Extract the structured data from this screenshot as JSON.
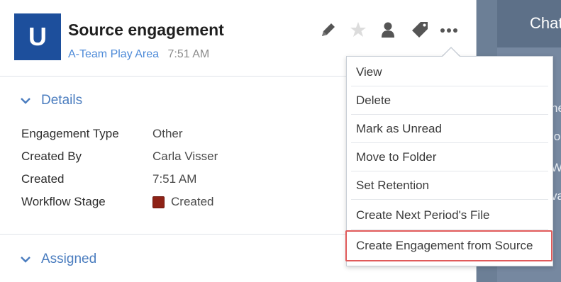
{
  "engagement": {
    "avatar_letter": "U",
    "title": "Source engagement",
    "folder": "A-Team Play Area",
    "time": "7:51 AM"
  },
  "toolbar": {
    "icons": [
      "pencil-icon",
      "star-icon",
      "person-icon",
      "tag-icon",
      "more-icon"
    ]
  },
  "details": {
    "heading": "Details",
    "fields": [
      {
        "label": "Engagement Type",
        "value": "Other"
      },
      {
        "label": "Created By",
        "value": "Carla Visser"
      },
      {
        "label": "Created",
        "value": "7:51 AM"
      },
      {
        "label": "Workflow Stage",
        "value": "Created"
      }
    ],
    "stage_color": "#8e2216"
  },
  "assigned": {
    "heading": "Assigned"
  },
  "menu": {
    "items": [
      "View",
      "Delete",
      "Mark as Unread",
      "Move to Folder",
      "Set Retention",
      "Create Next Period's File",
      "Create Engagement from Source"
    ],
    "highlight_color": "#e05a5a"
  },
  "chat": {
    "title": "Chat",
    "fragments": [
      "ne",
      "io",
      "Wi",
      "va"
    ]
  }
}
